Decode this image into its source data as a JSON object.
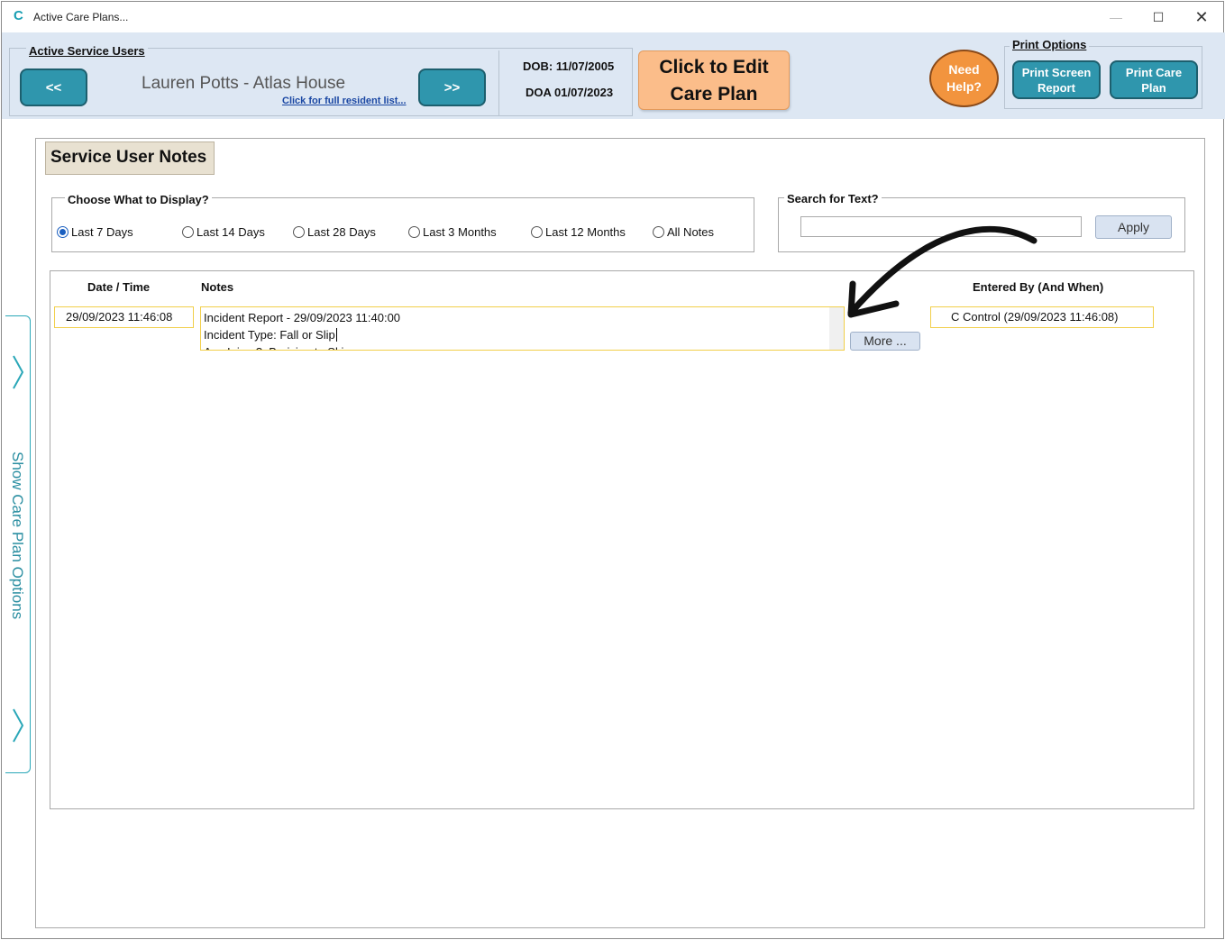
{
  "window": {
    "title": "Active Care Plans...",
    "minimize": "—",
    "maximize": "☐",
    "close": "✕"
  },
  "header": {
    "service_users_legend": "Active Service Users",
    "prev_label": "<<",
    "next_label": ">>",
    "resident_name": "Lauren Potts - Atlas House",
    "resident_list_link": "Click for full resident list...",
    "dob": "DOB: 11/07/2005",
    "doa": "DOA 01/07/2023",
    "edit_line1": "Click to Edit",
    "edit_line2": "Care Plan",
    "help_line1": "Need",
    "help_line2": "Help?",
    "print_legend": "Print Options",
    "print_screen_line1": "Print Screen",
    "print_screen_line2": "Report",
    "print_care_line1": "Print Care",
    "print_care_line2": "Plan"
  },
  "side_panel": {
    "label": "Show Care Plan Options"
  },
  "main": {
    "section_title": "Service User Notes",
    "display_legend": "Choose What to Display?",
    "display_options": [
      {
        "label": "Last 7 Days",
        "selected": true
      },
      {
        "label": "Last 14 Days",
        "selected": false
      },
      {
        "label": "Last 28 Days",
        "selected": false
      },
      {
        "label": "Last 3 Months",
        "selected": false
      },
      {
        "label": "Last 12 Months",
        "selected": false
      },
      {
        "label": "All Notes",
        "selected": false
      }
    ],
    "search_legend": "Search for Text?",
    "search_value": "",
    "apply_label": "Apply",
    "columns": {
      "datetime": "Date / Time",
      "notes": "Notes",
      "entered_by": "Entered By (And When)"
    },
    "rows": [
      {
        "datetime": "29/09/2023 11:46:08",
        "note_line1": "Incident Report - 29/09/2023 11:40:00",
        "note_line2": "Incident Type: Fall or Slip",
        "note_line3": "Any Injury?: Bruising to Skin",
        "more_label": "More ...",
        "entered_by": "C Control (29/09/2023 11:46:08)"
      }
    ]
  },
  "colors": {
    "accent_teal": "#2f96ad",
    "header_bg": "#dde7f3",
    "edit_orange": "#fbbd8a",
    "help_orange": "#f2943e",
    "cell_border": "#f1cf4a"
  }
}
